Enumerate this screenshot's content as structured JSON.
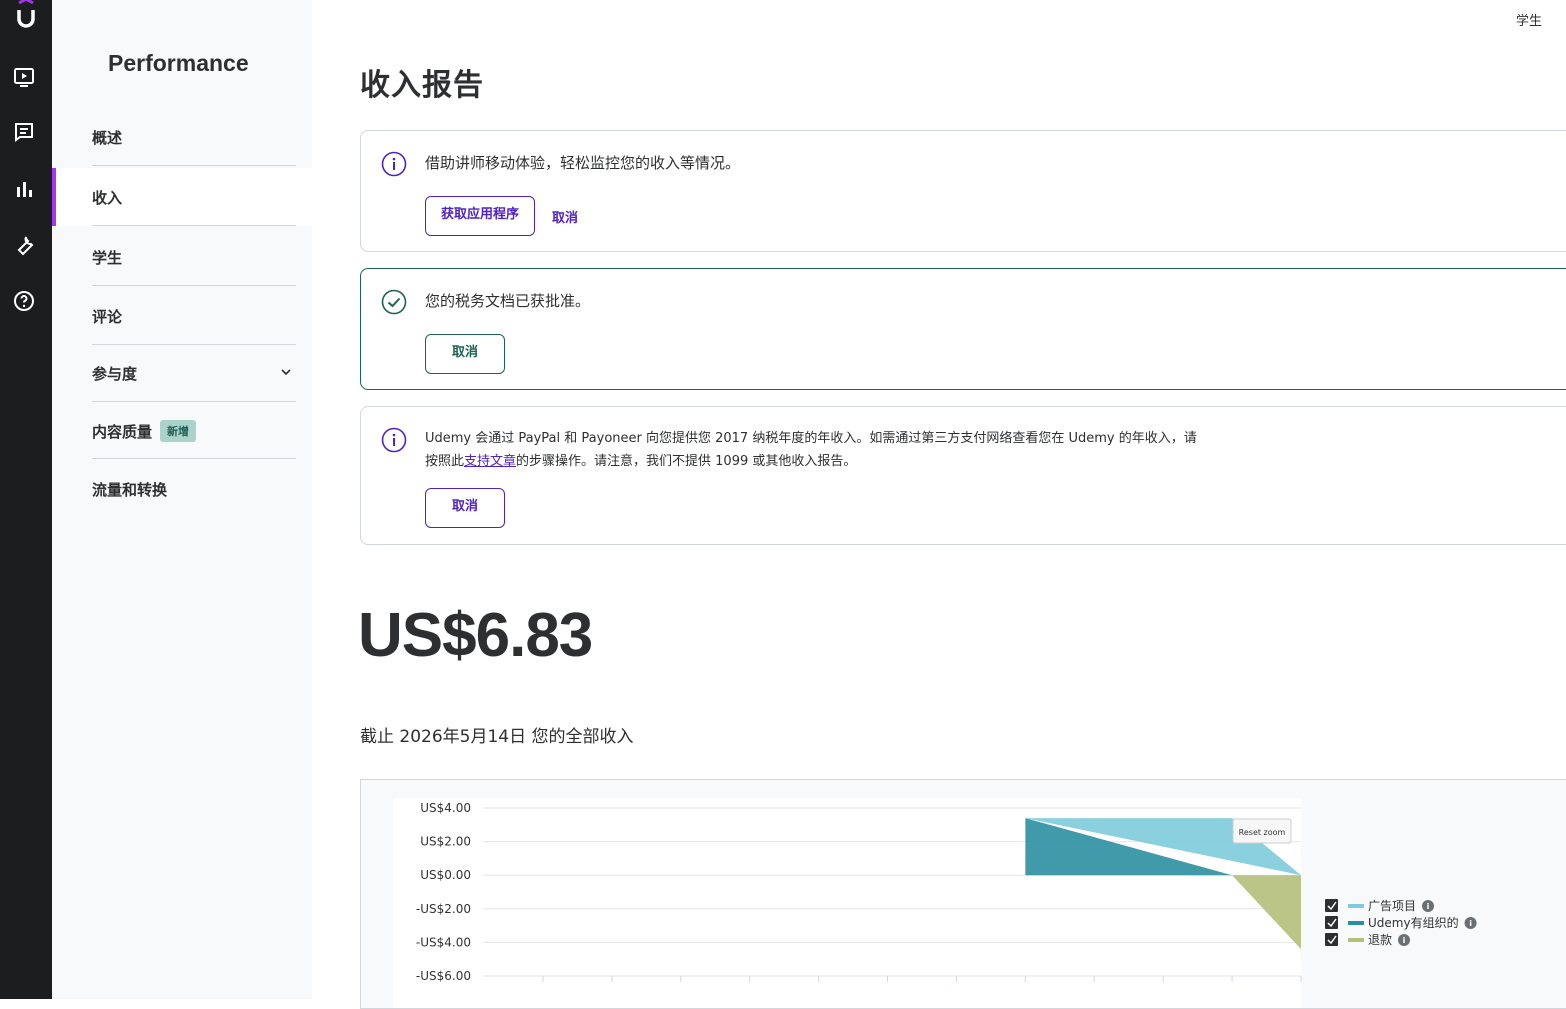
{
  "rail": {
    "icons": [
      "udemy-logo",
      "tv-play-icon",
      "message-icon",
      "bar-chart-icon",
      "wrench-icon",
      "help-icon"
    ]
  },
  "sidebar": {
    "title": "Performance",
    "items": [
      {
        "label": "概述"
      },
      {
        "label": "收入"
      },
      {
        "label": "学生"
      },
      {
        "label": "评论"
      },
      {
        "label": "参与度"
      },
      {
        "label": "内容质量",
        "badge": "新增"
      },
      {
        "label": "流量和转换"
      }
    ]
  },
  "header": {
    "user_link": "学生",
    "title": "收入报告"
  },
  "cards": {
    "app": {
      "message": "借助讲师移动体验，轻松监控您的收入等情况。",
      "primary": "获取应用程序",
      "dismiss": "取消"
    },
    "tax": {
      "message": "您的税务文档已获批准。",
      "dismiss": "取消"
    },
    "info": {
      "line1": "Udemy 会通过 PayPal 和 Payoneer 向您提供您 2017 纳税年度的年收入。如需通过第三方支付网络查看您在 Udemy 的年收入，请",
      "line2_pre": "按照此",
      "line2_link": "支持文章",
      "line2_post": "的步骤操作。请注意，我们不提供 1099 或其他收入报告。",
      "dismiss": "取消"
    }
  },
  "total": {
    "amount": "US$6.83",
    "caption": "截止 2026年5月14日 您的全部收入"
  },
  "chart_data": {
    "type": "area",
    "y_ticks": [
      "US$4.00",
      "US$2.00",
      "US$0.00",
      "-US$2.00",
      "-US$4.00",
      "-US$6.00"
    ],
    "ylim": [
      -6,
      4
    ],
    "reset_zoom_label": "Reset zoom",
    "x_count": 12,
    "series": [
      {
        "name": "广告项目",
        "color": "#7ecbdb",
        "points": [
          [
            7,
            3.4
          ],
          [
            10,
            3.4
          ],
          [
            11,
            0
          ]
        ]
      },
      {
        "name": "Udemy有组织的",
        "color": "#2b8fa0",
        "points": [
          [
            7,
            3.4
          ],
          [
            10,
            0
          ],
          [
            7,
            0
          ]
        ]
      },
      {
        "name": "退款",
        "color": "#b4bf7a",
        "points": [
          [
            10,
            0
          ],
          [
            11,
            0
          ],
          [
            11,
            -4.4
          ]
        ]
      }
    ],
    "legend_position": "right"
  }
}
